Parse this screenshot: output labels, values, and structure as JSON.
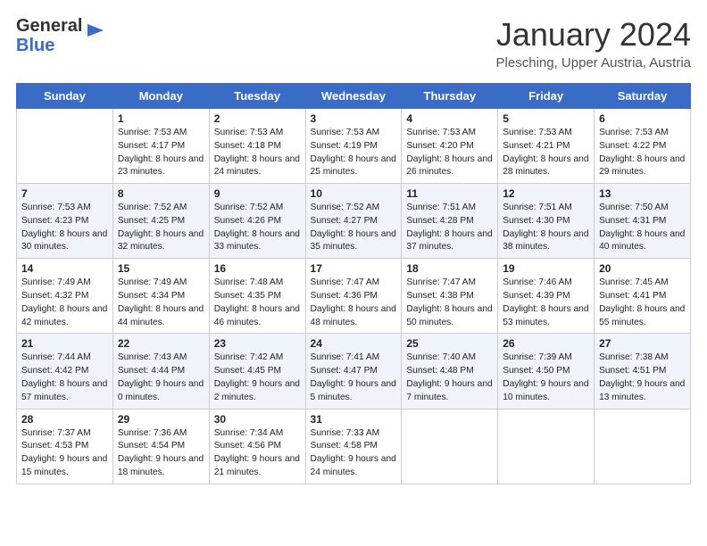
{
  "logo": {
    "general": "General",
    "blue": "Blue"
  },
  "header": {
    "month_title": "January 2024",
    "subtitle": "Plesching, Upper Austria, Austria"
  },
  "days_of_week": [
    "Sunday",
    "Monday",
    "Tuesday",
    "Wednesday",
    "Thursday",
    "Friday",
    "Saturday"
  ],
  "weeks": [
    [
      {
        "day": "",
        "sunrise": "",
        "sunset": "",
        "daylight": ""
      },
      {
        "day": "1",
        "sunrise": "Sunrise: 7:53 AM",
        "sunset": "Sunset: 4:17 PM",
        "daylight": "Daylight: 8 hours and 23 minutes."
      },
      {
        "day": "2",
        "sunrise": "Sunrise: 7:53 AM",
        "sunset": "Sunset: 4:18 PM",
        "daylight": "Daylight: 8 hours and 24 minutes."
      },
      {
        "day": "3",
        "sunrise": "Sunrise: 7:53 AM",
        "sunset": "Sunset: 4:19 PM",
        "daylight": "Daylight: 8 hours and 25 minutes."
      },
      {
        "day": "4",
        "sunrise": "Sunrise: 7:53 AM",
        "sunset": "Sunset: 4:20 PM",
        "daylight": "Daylight: 8 hours and 26 minutes."
      },
      {
        "day": "5",
        "sunrise": "Sunrise: 7:53 AM",
        "sunset": "Sunset: 4:21 PM",
        "daylight": "Daylight: 8 hours and 28 minutes."
      },
      {
        "day": "6",
        "sunrise": "Sunrise: 7:53 AM",
        "sunset": "Sunset: 4:22 PM",
        "daylight": "Daylight: 8 hours and 29 minutes."
      }
    ],
    [
      {
        "day": "7",
        "sunrise": "Sunrise: 7:53 AM",
        "sunset": "Sunset: 4:23 PM",
        "daylight": "Daylight: 8 hours and 30 minutes."
      },
      {
        "day": "8",
        "sunrise": "Sunrise: 7:52 AM",
        "sunset": "Sunset: 4:25 PM",
        "daylight": "Daylight: 8 hours and 32 minutes."
      },
      {
        "day": "9",
        "sunrise": "Sunrise: 7:52 AM",
        "sunset": "Sunset: 4:26 PM",
        "daylight": "Daylight: 8 hours and 33 minutes."
      },
      {
        "day": "10",
        "sunrise": "Sunrise: 7:52 AM",
        "sunset": "Sunset: 4:27 PM",
        "daylight": "Daylight: 8 hours and 35 minutes."
      },
      {
        "day": "11",
        "sunrise": "Sunrise: 7:51 AM",
        "sunset": "Sunset: 4:28 PM",
        "daylight": "Daylight: 8 hours and 37 minutes."
      },
      {
        "day": "12",
        "sunrise": "Sunrise: 7:51 AM",
        "sunset": "Sunset: 4:30 PM",
        "daylight": "Daylight: 8 hours and 38 minutes."
      },
      {
        "day": "13",
        "sunrise": "Sunrise: 7:50 AM",
        "sunset": "Sunset: 4:31 PM",
        "daylight": "Daylight: 8 hours and 40 minutes."
      }
    ],
    [
      {
        "day": "14",
        "sunrise": "Sunrise: 7:49 AM",
        "sunset": "Sunset: 4:32 PM",
        "daylight": "Daylight: 8 hours and 42 minutes."
      },
      {
        "day": "15",
        "sunrise": "Sunrise: 7:49 AM",
        "sunset": "Sunset: 4:34 PM",
        "daylight": "Daylight: 8 hours and 44 minutes."
      },
      {
        "day": "16",
        "sunrise": "Sunrise: 7:48 AM",
        "sunset": "Sunset: 4:35 PM",
        "daylight": "Daylight: 8 hours and 46 minutes."
      },
      {
        "day": "17",
        "sunrise": "Sunrise: 7:47 AM",
        "sunset": "Sunset: 4:36 PM",
        "daylight": "Daylight: 8 hours and 48 minutes."
      },
      {
        "day": "18",
        "sunrise": "Sunrise: 7:47 AM",
        "sunset": "Sunset: 4:38 PM",
        "daylight": "Daylight: 8 hours and 50 minutes."
      },
      {
        "day": "19",
        "sunrise": "Sunrise: 7:46 AM",
        "sunset": "Sunset: 4:39 PM",
        "daylight": "Daylight: 8 hours and 53 minutes."
      },
      {
        "day": "20",
        "sunrise": "Sunrise: 7:45 AM",
        "sunset": "Sunset: 4:41 PM",
        "daylight": "Daylight: 8 hours and 55 minutes."
      }
    ],
    [
      {
        "day": "21",
        "sunrise": "Sunrise: 7:44 AM",
        "sunset": "Sunset: 4:42 PM",
        "daylight": "Daylight: 8 hours and 57 minutes."
      },
      {
        "day": "22",
        "sunrise": "Sunrise: 7:43 AM",
        "sunset": "Sunset: 4:44 PM",
        "daylight": "Daylight: 9 hours and 0 minutes."
      },
      {
        "day": "23",
        "sunrise": "Sunrise: 7:42 AM",
        "sunset": "Sunset: 4:45 PM",
        "daylight": "Daylight: 9 hours and 2 minutes."
      },
      {
        "day": "24",
        "sunrise": "Sunrise: 7:41 AM",
        "sunset": "Sunset: 4:47 PM",
        "daylight": "Daylight: 9 hours and 5 minutes."
      },
      {
        "day": "25",
        "sunrise": "Sunrise: 7:40 AM",
        "sunset": "Sunset: 4:48 PM",
        "daylight": "Daylight: 9 hours and 7 minutes."
      },
      {
        "day": "26",
        "sunrise": "Sunrise: 7:39 AM",
        "sunset": "Sunset: 4:50 PM",
        "daylight": "Daylight: 9 hours and 10 minutes."
      },
      {
        "day": "27",
        "sunrise": "Sunrise: 7:38 AM",
        "sunset": "Sunset: 4:51 PM",
        "daylight": "Daylight: 9 hours and 13 minutes."
      }
    ],
    [
      {
        "day": "28",
        "sunrise": "Sunrise: 7:37 AM",
        "sunset": "Sunset: 4:53 PM",
        "daylight": "Daylight: 9 hours and 15 minutes."
      },
      {
        "day": "29",
        "sunrise": "Sunrise: 7:36 AM",
        "sunset": "Sunset: 4:54 PM",
        "daylight": "Daylight: 9 hours and 18 minutes."
      },
      {
        "day": "30",
        "sunrise": "Sunrise: 7:34 AM",
        "sunset": "Sunset: 4:56 PM",
        "daylight": "Daylight: 9 hours and 21 minutes."
      },
      {
        "day": "31",
        "sunrise": "Sunrise: 7:33 AM",
        "sunset": "Sunset: 4:58 PM",
        "daylight": "Daylight: 9 hours and 24 minutes."
      },
      {
        "day": "",
        "sunrise": "",
        "sunset": "",
        "daylight": ""
      },
      {
        "day": "",
        "sunrise": "",
        "sunset": "",
        "daylight": ""
      },
      {
        "day": "",
        "sunrise": "",
        "sunset": "",
        "daylight": ""
      }
    ]
  ]
}
